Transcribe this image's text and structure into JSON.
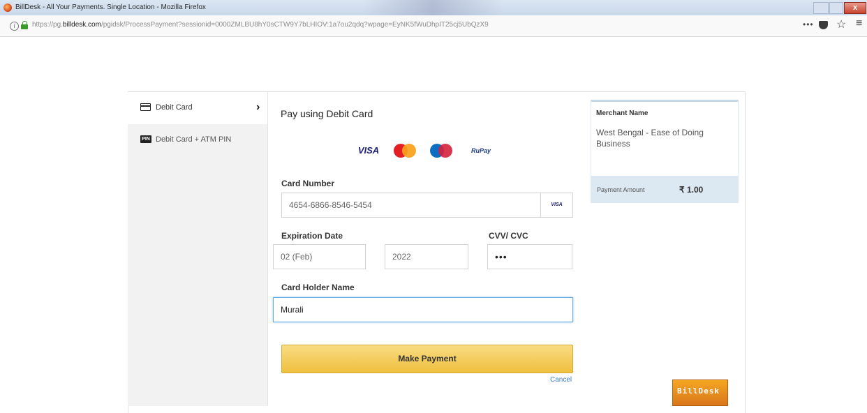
{
  "window": {
    "title": "BillDesk - All Your Payments. Single Location - Mozilla Firefox",
    "close_label": "x"
  },
  "browser": {
    "url_prefix": "https://pg.",
    "url_domain": "billdesk.com",
    "url_rest": "/pgidsk/ProcessPayment?sessionid=0000ZMLBU8hY0sCTW9Y7bLHIOV:1a7ou2qdq?wpage=EyNK5fWuDhpIT25cj5UbQzX9",
    "more_label": "•••",
    "star_glyph": "☆",
    "menu_glyph": "≡"
  },
  "sidebar": {
    "items": [
      {
        "label": "Debit Card",
        "icon": "card-icon",
        "active": true
      },
      {
        "label": "Debit Card + ATM PIN",
        "icon": "pin-icon",
        "icon_text": "PIN",
        "active": false
      }
    ],
    "chevron": "›"
  },
  "form": {
    "heading": "Pay using Debit Card",
    "logos": [
      "VISA",
      "MasterCard",
      "Maestro",
      "RuPay"
    ],
    "logo_visa_text": "VISA",
    "logo_rupay_text": "RuPay",
    "card_number_label": "Card Number",
    "card_number_value": "4654-6866-8546-5454",
    "card_brand": "VISA",
    "expiration_label": "Expiration Date",
    "exp_month_value": "02 (Feb)",
    "exp_year_value": "2022",
    "cvv_label": "CVV/ CVC",
    "cvv_value": "•••",
    "holder_label": "Card Holder Name",
    "holder_value": "Murali",
    "pay_button": "Make Payment",
    "cancel_link": "Cancel"
  },
  "merchant": {
    "label": "Merchant Name",
    "name": "West Bengal - Ease of Doing Business",
    "amount_label": "Payment Amount",
    "amount_value": "₹ 1.00"
  },
  "footer": {
    "brand": "BillDesk"
  }
}
